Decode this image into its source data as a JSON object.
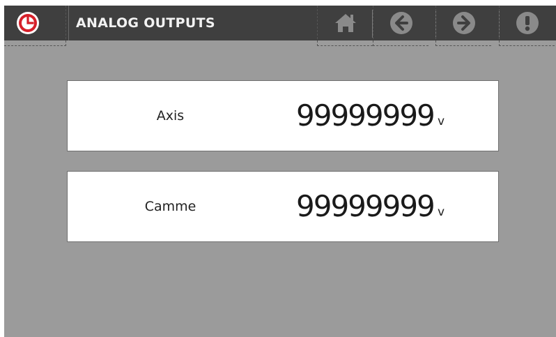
{
  "header": {
    "title": "ANALOG OUTPUTS",
    "logo_icon": "clock-icon",
    "nav": [
      {
        "icon": "home-icon"
      },
      {
        "icon": "back-arrow-icon"
      },
      {
        "icon": "forward-arrow-icon"
      },
      {
        "icon": "info-icon"
      }
    ]
  },
  "outputs": [
    {
      "label": "Axis",
      "value": "99999999",
      "unit": "v"
    },
    {
      "label": "Camme",
      "value": "99999999",
      "unit": "v"
    }
  ],
  "colors": {
    "background": "#9b9b9b",
    "topbar": "#3f3f3f",
    "accent": "#d6202a",
    "icon": "#8a8a8a"
  }
}
